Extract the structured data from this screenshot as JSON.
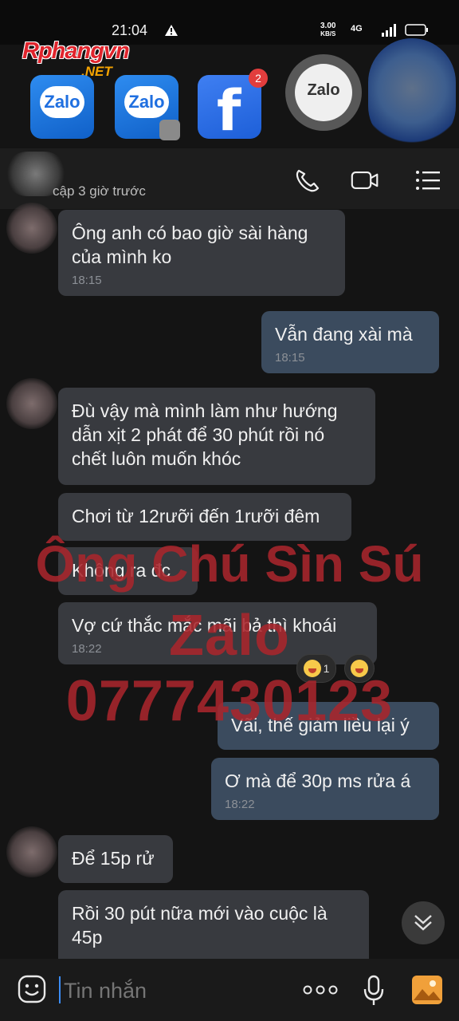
{
  "status_bar": {
    "time": "21:04",
    "net_speed_value": "3.00",
    "net_speed_unit": "KB/S",
    "net_type": "4G",
    "icons": [
      "alert-icon",
      "signal-icon",
      "battery-icon"
    ]
  },
  "watermark_logo": {
    "name": "Rphangvn",
    "suffix": ".NET"
  },
  "floating_heads": [
    {
      "icon": "zalo-app-icon",
      "label": "Zalo"
    },
    {
      "icon": "zalo-clone-icon",
      "label": "Zalo"
    },
    {
      "icon": "facebook-icon",
      "label": "f",
      "badge": "2"
    },
    {
      "icon": "zalo-bubble-icon",
      "label": "Zalo"
    }
  ],
  "header": {
    "last_seen": "cập 3 giờ trước",
    "actions": [
      "call-icon",
      "video-icon",
      "menu-icon"
    ]
  },
  "messages": [
    {
      "dir": "in",
      "lines": [
        "Ông anh có bao giờ sài hàng",
        "của mình ko"
      ],
      "time": "18:15"
    },
    {
      "dir": "out",
      "lines": [
        "Vẫn đang xài mà"
      ],
      "time": "18:15"
    },
    {
      "dir": "in",
      "lines": [
        "Đù vậy mà mình làm như hướng",
        "dẫn xịt 2 phát để 30 phút rồi nó",
        "chết luôn muốn khóc"
      ],
      "time": ""
    },
    {
      "dir": "in",
      "lines": [
        "Chơi từ 12rưỡi đến 1rưỡi đêm"
      ],
      "time": ""
    },
    {
      "dir": "in",
      "lines": [
        "Không ra đc"
      ],
      "time": ""
    },
    {
      "dir": "in",
      "lines": [
        "Vợ cứ thắc mắc mãi bả thì khoái"
      ],
      "time": "18:22"
    },
    {
      "dir": "out",
      "lines": [
        "Vãi, thế giảm liều lại ý"
      ],
      "time": ""
    },
    {
      "dir": "out",
      "lines": [
        "Ơ mà để 30p ms rửa á"
      ],
      "time": "18:22"
    },
    {
      "dir": "in",
      "lines": [
        "Để 15p rử"
      ],
      "time": ""
    },
    {
      "dir": "in",
      "lines": [
        "Rồi 30 pút nữa mới vào cuộc là",
        "45p"
      ],
      "time": ""
    }
  ],
  "reactions": {
    "emoji": "laugh-cry",
    "count": "1"
  },
  "overlay_watermark": {
    "line1": "Ông Chú Sìn Sú",
    "line2": "Zalo 0777430123"
  },
  "composer": {
    "placeholder": "Tin nhắn",
    "icons": [
      "emoji-icon",
      "more-icon",
      "mic-icon",
      "gallery-icon"
    ]
  },
  "colors": {
    "background": "#141414",
    "incoming_bubble": "#383a3f",
    "outgoing_bubble": "#3b4b5e",
    "watermark": "#a8262c",
    "caret": "#3b8cf5"
  }
}
